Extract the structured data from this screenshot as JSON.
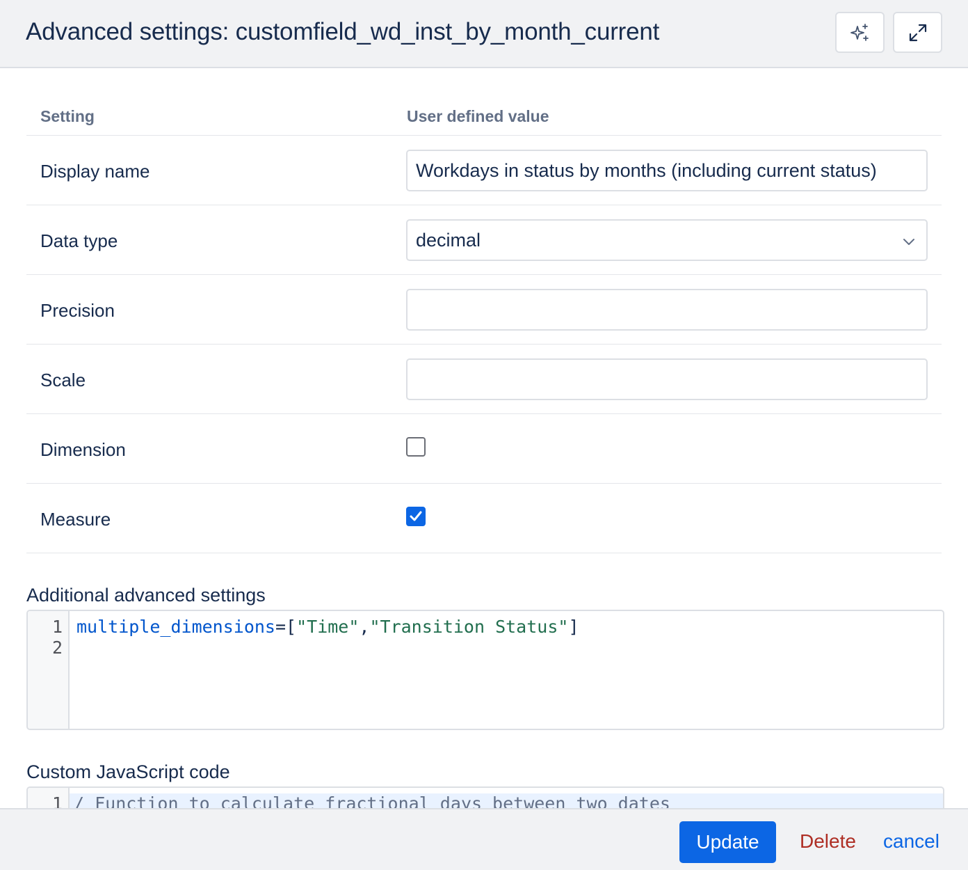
{
  "header": {
    "title": "Advanced settings: customfield_wd_inst_by_month_current",
    "ai_button_icon": "sparkles-icon",
    "expand_button_icon": "expand-icon"
  },
  "table": {
    "columns": [
      "Setting",
      "User defined value"
    ],
    "rows": {
      "display_name": {
        "label": "Display name",
        "value": "Workdays in status by months (including current status)"
      },
      "data_type": {
        "label": "Data type",
        "value": "decimal",
        "icon": "chevron-down-icon"
      },
      "precision": {
        "label": "Precision",
        "value": ""
      },
      "scale": {
        "label": "Scale",
        "value": ""
      },
      "dimension": {
        "label": "Dimension",
        "checked": false
      },
      "measure": {
        "label": "Measure",
        "checked": true
      }
    }
  },
  "additional_settings": {
    "label": "Additional advanced settings",
    "line_numbers": [
      "1",
      "2"
    ],
    "line1": {
      "key": "multiple_dimensions",
      "eq": "=[",
      "str1": "\"Time\"",
      "comma": ",",
      "str2": "\"Transition Status\"",
      "close": "]"
    }
  },
  "custom_js": {
    "label": "Custom JavaScript code",
    "line_numbers": [
      "1"
    ],
    "line1": "/ Function to calculate fractional days between two dates"
  },
  "footer": {
    "update_label": "Update",
    "delete_label": "Delete",
    "cancel_label": "cancel"
  },
  "colors": {
    "primary": "#0c66e4",
    "danger": "#ae2e24",
    "header_bg": "#f1f2f4"
  }
}
